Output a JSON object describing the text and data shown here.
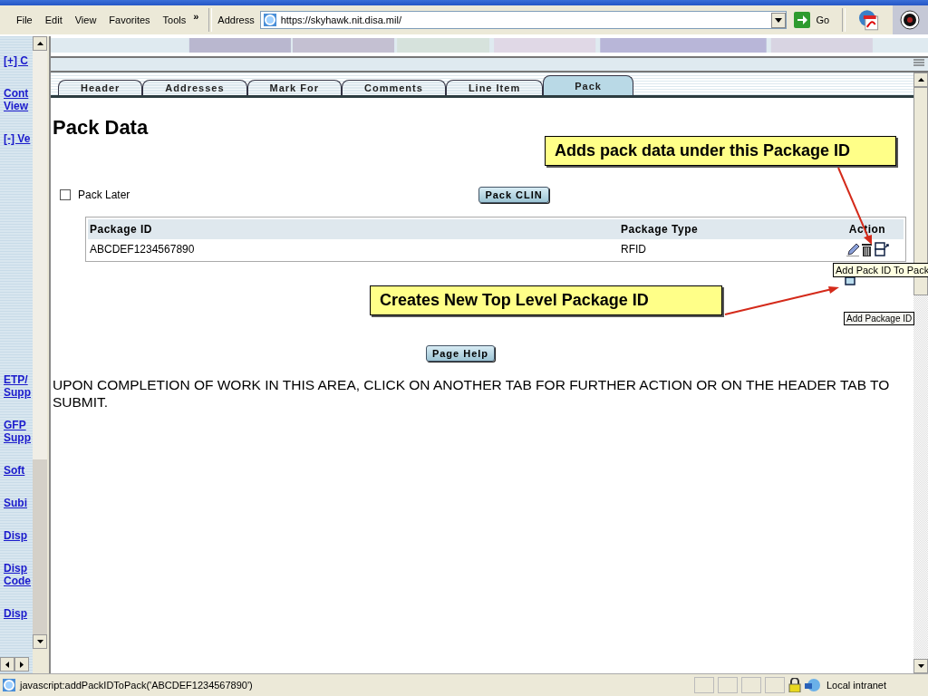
{
  "browser": {
    "menu": [
      "File",
      "Edit",
      "View",
      "Favorites",
      "Tools"
    ],
    "overflow": "»",
    "address_label": "Address",
    "url": "https://skyhawk.nit.disa.mil/",
    "go": "Go"
  },
  "sidebar": {
    "items": [
      {
        "lines": [
          "[+] C"
        ]
      },
      {
        "lines": [
          "Cont",
          "View"
        ]
      },
      {
        "lines": [
          "[-] Ve"
        ]
      },
      {
        "lines": [
          "ETP/",
          "Supp"
        ]
      },
      {
        "lines": [
          "GFP",
          "Supp"
        ]
      },
      {
        "lines": [
          "Soft"
        ]
      },
      {
        "lines": [
          "Subi"
        ]
      },
      {
        "lines": [
          "Disp"
        ]
      },
      {
        "lines": [
          "Disp",
          "Code"
        ]
      },
      {
        "lines": [
          "Disp"
        ]
      }
    ]
  },
  "tabs": [
    {
      "label": "Header",
      "selected": false
    },
    {
      "label": "Addresses",
      "selected": false
    },
    {
      "label": "Mark For",
      "selected": false
    },
    {
      "label": "Comments",
      "selected": false
    },
    {
      "label": "Line Item",
      "selected": false
    },
    {
      "label": "Pack",
      "selected": true
    }
  ],
  "page": {
    "title": "Pack Data",
    "pack_later": {
      "label": "Pack Later",
      "checked": false
    },
    "pack_clin": "Pack CLIN",
    "table": {
      "columns": [
        "Package ID",
        "Package Type",
        "Action"
      ],
      "rows": [
        {
          "package_id": "ABCDEF1234567890",
          "package_type": "RFID"
        }
      ]
    },
    "page_help": "Page Help",
    "message": "UPON COMPLETION OF WORK IN THIS AREA, CLICK ON ANOTHER TAB FOR FURTHER ACTION OR ON THE HEADER TAB TO SUBMIT."
  },
  "callouts": [
    "Adds pack data under this Package ID",
    "Creates New Top Level Package ID"
  ],
  "tooltips": [
    "Add Pack ID To Pack",
    "Add Package ID"
  ],
  "status_bar": {
    "text": "javascript:addPackIDToPack('ABCDEF1234567890')",
    "zone": "Local intranet"
  }
}
